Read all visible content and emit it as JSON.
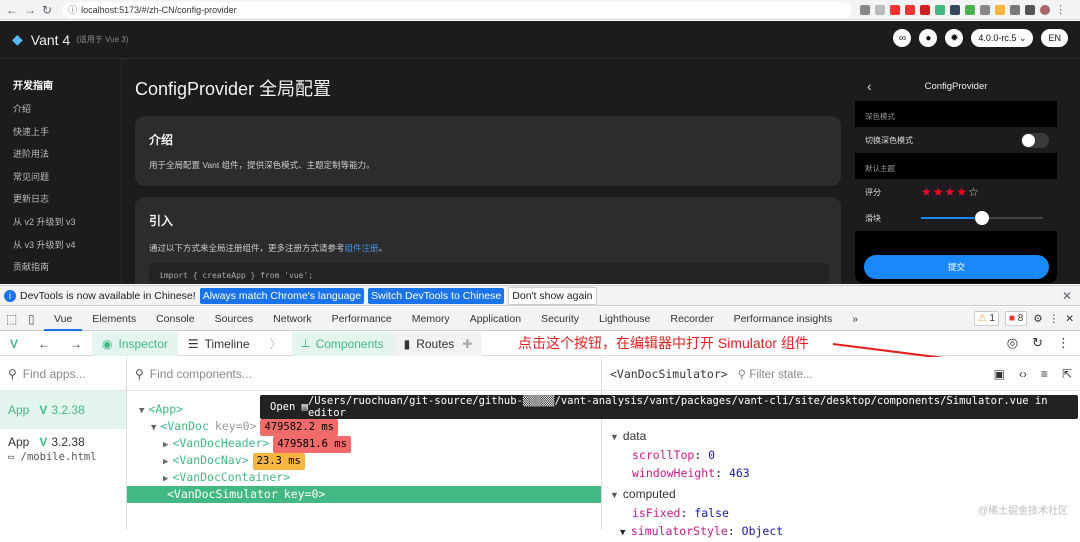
{
  "browser": {
    "url": "localhost:5173/#/zh-CN/config-provider"
  },
  "site": {
    "logo_title": "Vant 4",
    "logo_sub": "(适用于 Vue 3)",
    "version": "4.0.0-rc.5",
    "lang": "EN",
    "sidebar": {
      "group": "开发指南",
      "items": [
        "介绍",
        "快速上手",
        "进阶用法",
        "常见问题",
        "更新日志",
        "从 v2 升级到 v3",
        "从 v3 升级到 v4",
        "贡献指南"
      ]
    },
    "page_title": "ConfigProvider 全局配置",
    "intro": {
      "title": "介绍",
      "desc": "用于全局配置 Vant 组件，提供深色模式、主题定制等能力。"
    },
    "import": {
      "title": "引入",
      "desc": "通过以下方式来全局注册组件，更多注册方式请参考",
      "link": "组件注册",
      "tail": "。",
      "code": "import { createApp } from 'vue';"
    }
  },
  "simulator": {
    "title": "ConfigProvider",
    "dark_label": "深色模式",
    "toggle_label": "切换深色模式",
    "theme_label": "默认主题",
    "rate_label": "评分",
    "slider_label": "滑块",
    "rate_value": 4,
    "rate_count": 5,
    "slider_value": 0.5,
    "submit": "提交"
  },
  "infobar": {
    "msg": "DevTools is now available in Chinese!",
    "btn1": "Always match Chrome's language",
    "btn2": "Switch DevTools to Chinese",
    "btn3": "Don't show again"
  },
  "devtools": {
    "tabs": [
      "Vue",
      "Elements",
      "Console",
      "Sources",
      "Network",
      "Performance",
      "Memory",
      "Application",
      "Security",
      "Lighthouse",
      "Recorder",
      "Performance insights"
    ],
    "warn_count": "1",
    "err_count": "8"
  },
  "vue": {
    "toolbar": {
      "inspector": "Inspector",
      "timeline": "Timeline",
      "components": "Components",
      "routes": "Routes"
    },
    "annotation": "点击这个按钮，在编辑器中打开 Simulator 组件",
    "find_apps": "Find apps...",
    "apps": [
      {
        "name": "App",
        "version": "3.2.38",
        "url": ""
      },
      {
        "name": "App",
        "version": "3.2.38",
        "url": "/mobile.html"
      }
    ],
    "find_components": "Find components...",
    "tree": [
      {
        "name": "<App>",
        "key": "",
        "time": "",
        "level": 0,
        "arrow": "▼"
      },
      {
        "name": "<VanDoc",
        "key": "key=0>",
        "time": "479582.2 ms",
        "level": 1,
        "arrow": "▼",
        "tc": "r"
      },
      {
        "name": "<VanDocHeader>",
        "key": "",
        "time": "479581.6 ms",
        "level": 2,
        "arrow": "▶",
        "tc": "r"
      },
      {
        "name": "<VanDocNav>",
        "key": "",
        "time": "23.3 ms",
        "level": 2,
        "arrow": "▶",
        "tc": "y"
      },
      {
        "name": "<VanDocContainer>",
        "key": "",
        "time": "",
        "level": 2,
        "arrow": "▶"
      },
      {
        "name": "<VanDocSimulator",
        "key": "key=0>",
        "time": "",
        "level": 2,
        "arrow": "",
        "sel": true
      }
    ],
    "tooltip_prefix": "Open",
    "tooltip_path": "/Users/ruochuan/git-source/github-▒▒▒▒▒/vant-analysis/vant/packages/vant-cli/site/desktop/components/Simulator.vue in editor",
    "selected": "<VanDocSimulator>",
    "filter_state": "Filter state...",
    "data_label": "data",
    "props": [
      {
        "k": "scrollTop",
        "v": "0"
      },
      {
        "k": "windowHeight",
        "v": "463"
      }
    ],
    "computed_label": "computed",
    "computed": [
      {
        "k": "isFixed",
        "v": "false"
      },
      {
        "k": "simulatorStyle",
        "v": "Object"
      }
    ],
    "watermark": "@稀土掘金技术社区"
  }
}
